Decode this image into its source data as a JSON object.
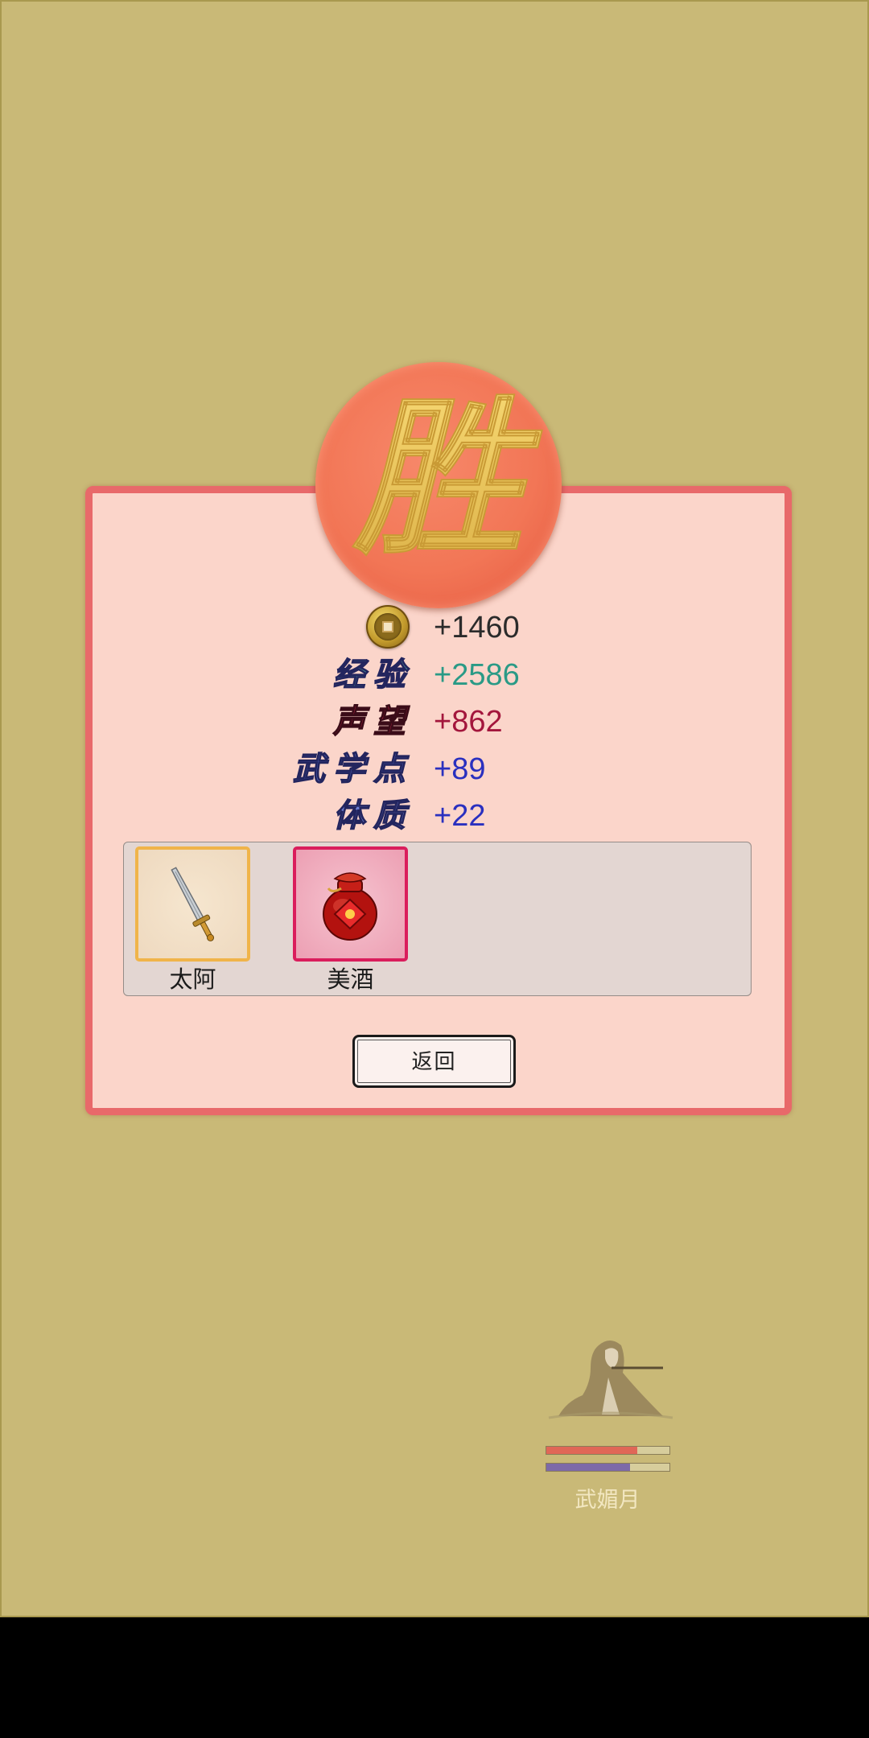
{
  "victory": {
    "glyph": "胜"
  },
  "rewards": {
    "coin": {
      "icon": "copper-coin-icon",
      "value": "+1460"
    },
    "experience": {
      "label": "经验",
      "value": "+2586",
      "color": "#2a9a86"
    },
    "prestige": {
      "label": "声望",
      "value": "+862",
      "color": "#a3163c"
    },
    "martial_points": {
      "label": "武学点",
      "value": "+89",
      "color": "#2a30bf"
    },
    "constitution": {
      "label": "体质",
      "value": "+22",
      "color": "#2a30bf"
    }
  },
  "items": [
    {
      "name": "太阿",
      "icon": "sword-icon",
      "frame_color": "#f0b44a"
    },
    {
      "name": "美酒",
      "icon": "wine-jar-icon",
      "frame_color": "#da1d5c"
    }
  ],
  "back_label": "返回",
  "character": {
    "name": "武媚月",
    "icon": "flute-player-portrait",
    "hp_fraction": 0.74,
    "mp_fraction": 0.68
  }
}
